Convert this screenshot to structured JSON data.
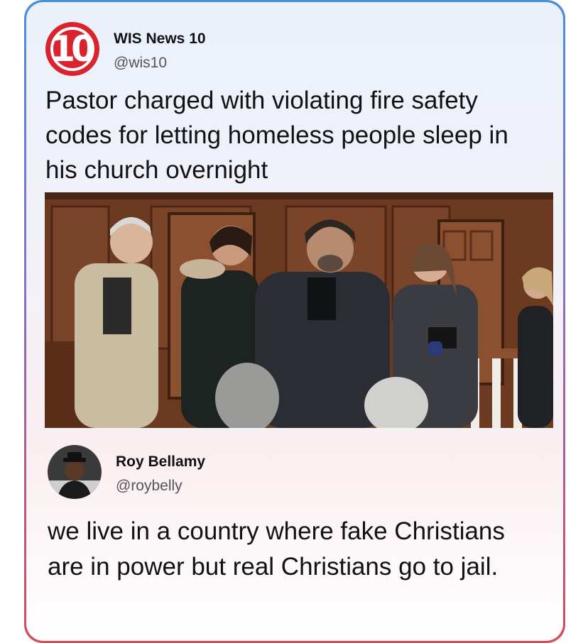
{
  "tweet1": {
    "logo_text": "10",
    "name": "WIS News 10",
    "handle": "@wis10",
    "text": "Pastor charged with violating fire safety codes for letting homeless people sleep in his church overnight"
  },
  "tweet2": {
    "name": "Roy Bellamy",
    "handle": "@roybelly",
    "text": "we live in a country where fake Christians are in power but real Christians go to jail."
  },
  "colors": {
    "frame_top": "#4b8fd9",
    "frame_bottom": "#d94a5a",
    "logo_red": "#d9232e"
  }
}
